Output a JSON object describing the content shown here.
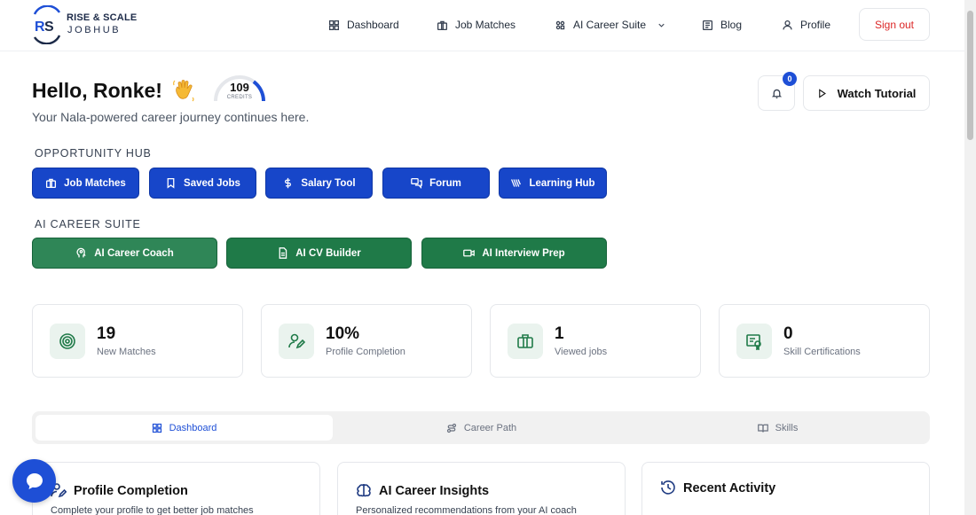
{
  "brand": {
    "line1": "RISE & SCALE",
    "line2": "JOBHUB"
  },
  "nav": {
    "dashboard": "Dashboard",
    "job_matches": "Job Matches",
    "ai_career_suite": "AI Career Suite",
    "blog": "Blog",
    "profile": "Profile",
    "sign_out": "Sign out"
  },
  "greeting": {
    "hello": "Hello, Ronke!",
    "subtitle": "Your Nala-powered career journey continues here.",
    "credits_value": "109",
    "credits_label": "CREDITS"
  },
  "notifications": {
    "count": "0"
  },
  "tutorial": {
    "label": "Watch Tutorial"
  },
  "opportunity_hub": {
    "label": "OPPORTUNITY HUB",
    "buttons": [
      "Job Matches",
      "Saved Jobs",
      "Salary Tool",
      "Forum",
      "Learning Hub"
    ]
  },
  "ai_suite": {
    "label": "AI CAREER SUITE",
    "buttons": [
      "AI Career Coach",
      "AI CV Builder",
      "AI Interview Prep"
    ]
  },
  "stats": [
    {
      "value": "19",
      "label": "New Matches",
      "icon": "target-icon"
    },
    {
      "value": "10%",
      "label": "Profile Completion",
      "icon": "user-edit-icon"
    },
    {
      "value": "1",
      "label": "Viewed jobs",
      "icon": "briefcase-icon"
    },
    {
      "value": "0",
      "label": "Skill Certifications",
      "icon": "certificate-icon"
    }
  ],
  "tabs": [
    "Dashboard",
    "Career Path",
    "Skills"
  ],
  "panels": [
    {
      "title": "Profile Completion",
      "subtitle": "Complete your profile to get better job matches"
    },
    {
      "title": "AI Career Insights",
      "subtitle": "Personalized recommendations from your AI coach"
    },
    {
      "title": "Recent Activity",
      "subtitle": ""
    }
  ],
  "colors": {
    "primary_blue": "#1746c9",
    "green": "#1f7a48",
    "sign_out_red": "#dc2626",
    "credits_arc": "#1e4fd6"
  },
  "credits_fraction": 0.3
}
